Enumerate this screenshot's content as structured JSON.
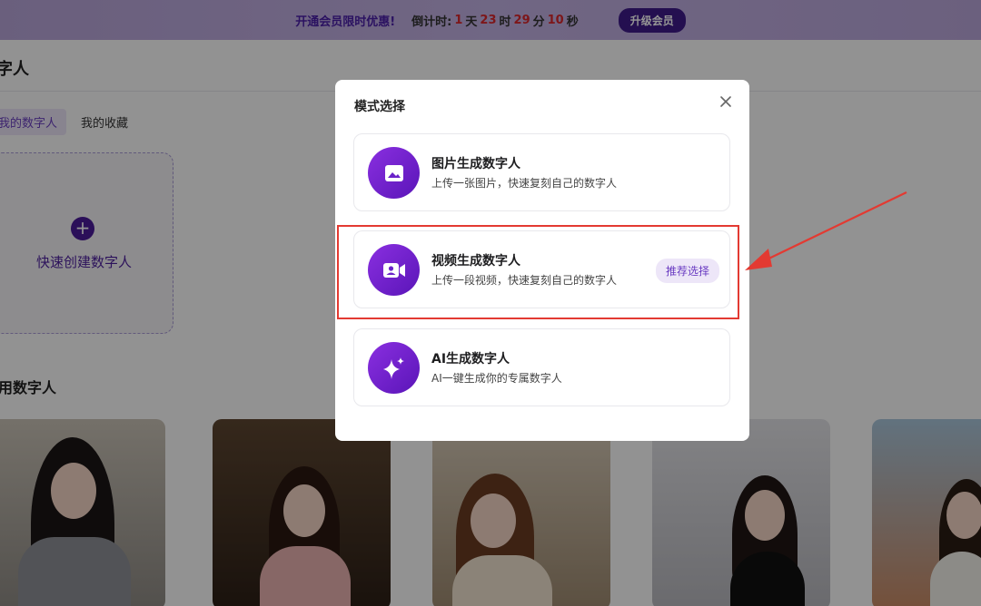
{
  "promo": {
    "text": "开通会员限时优惠!",
    "countdown_label": "倒计时:",
    "days": "1",
    "days_unit": "天",
    "hours": "23",
    "hours_unit": "时",
    "minutes": "29",
    "minutes_unit": "分",
    "seconds": "10",
    "seconds_unit": "秒",
    "upgrade_label": "升级会员"
  },
  "page": {
    "title": "字人",
    "tabs": [
      {
        "label": "我的数字人",
        "active": true
      },
      {
        "label": "我的收藏",
        "active": false
      }
    ],
    "create_label": "快速创建数字人",
    "section_title": "用数字人"
  },
  "modal": {
    "title": "模式选择",
    "options": [
      {
        "title": "图片生成数字人",
        "desc": "上传一张图片，快速复刻自己的数字人",
        "icon": "image-icon"
      },
      {
        "title": "视频生成数字人",
        "desc": "上传一段视频，快速复刻自己的数字人",
        "icon": "video-camera-icon",
        "badge": "推荐选择"
      },
      {
        "title": "AI生成数字人",
        "desc": "AI一键生成你的专属数字人",
        "icon": "sparkle-icon"
      }
    ]
  },
  "colors": {
    "accent": "#5a15b8",
    "highlight": "#e33a32",
    "countdown_number": "#d8262c"
  }
}
